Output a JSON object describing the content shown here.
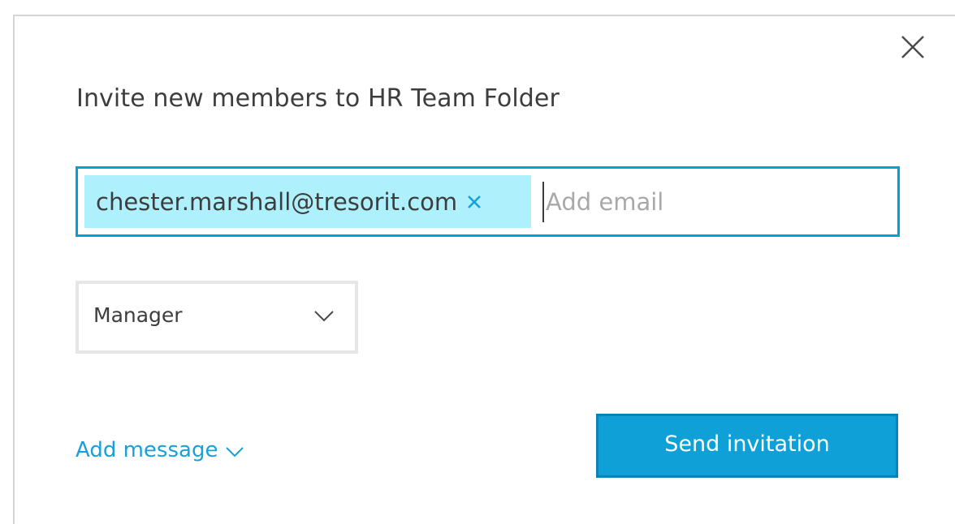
{
  "dialog": {
    "title": "Invite new members to HR Team Folder",
    "close_icon": "close-icon"
  },
  "email_field": {
    "chips": [
      {
        "label": "chester.marshall@tresorit.com",
        "remove_icon": "remove-icon"
      }
    ],
    "placeholder": "Add email",
    "value": ""
  },
  "role_select": {
    "selected": "Manager",
    "icon": "chevron-down-icon"
  },
  "add_message": {
    "label": "Add message",
    "icon": "chevron-down-icon"
  },
  "send_button": {
    "label": "Send invitation"
  },
  "colors": {
    "accent": "#00a0d8",
    "chip_background": "#aef0fb",
    "button_background": "#0fa0d7",
    "button_border": "#0783b4",
    "link": "#1aa0d8",
    "text": "#3d3d3d",
    "placeholder": "#a8a8a8"
  }
}
